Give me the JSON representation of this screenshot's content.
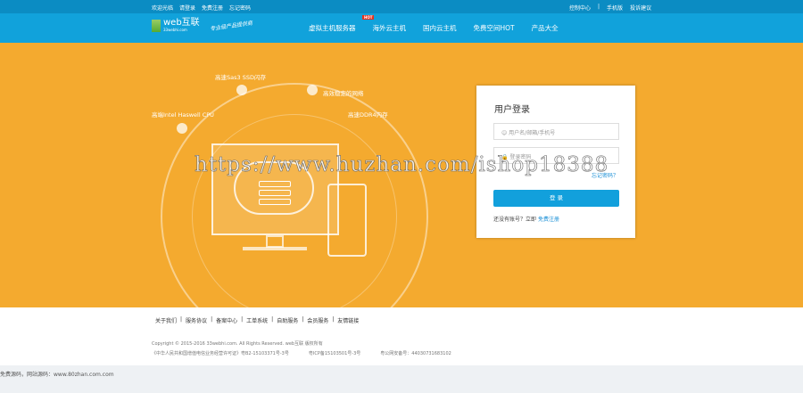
{
  "topbar": {
    "left": [
      "欢迎光临",
      "请登录",
      "免费注册",
      "忘记密码"
    ],
    "right": [
      "控制中心",
      "|",
      "手机版",
      "投诉建议"
    ]
  },
  "logo": {
    "name": "web互联",
    "domain": "33webhi.com",
    "slogan": "专业级产品提供商"
  },
  "nav": {
    "hot_badge": "HOT",
    "items": [
      "虚拟主机服务器",
      "海外云主机",
      "国内云主机",
      "免费空间HOT",
      "产品大全"
    ]
  },
  "hero": {
    "features": [
      "高速Sas3 SSD闪存",
      "高效稳定的网络",
      "高端Intel Haswell CPU",
      "高速DDR4内存"
    ]
  },
  "login": {
    "title": "用户登录",
    "username_placeholder": "用户名/邮箱/手机号",
    "password_placeholder": "登录密码",
    "forgot": "忘记密码？",
    "submit": "登 录",
    "register_prompt": "还没有账号？立即",
    "register_link": "免费注册"
  },
  "watermark": "https://www.huzhan.com/ishop18388",
  "footer": {
    "links": [
      "关于我们",
      "服务协议",
      "备案中心",
      "工单系统",
      "自助服务",
      "会员服务",
      "友情链接"
    ],
    "separator": "|",
    "copyright": "Copyright © 2015-2016 33webhi.com. All Rights Reserved. web互联 版权所有",
    "licenses": [
      "《中华人民共和国增值电信业务经营许可证》粤B2-15103371号-3号",
      "粤ICP备15103501号-3号",
      "粤公网安备号：44030731683102"
    ]
  },
  "bottom_note": "免费源码，网站源码：www.80zhan.com.com"
}
